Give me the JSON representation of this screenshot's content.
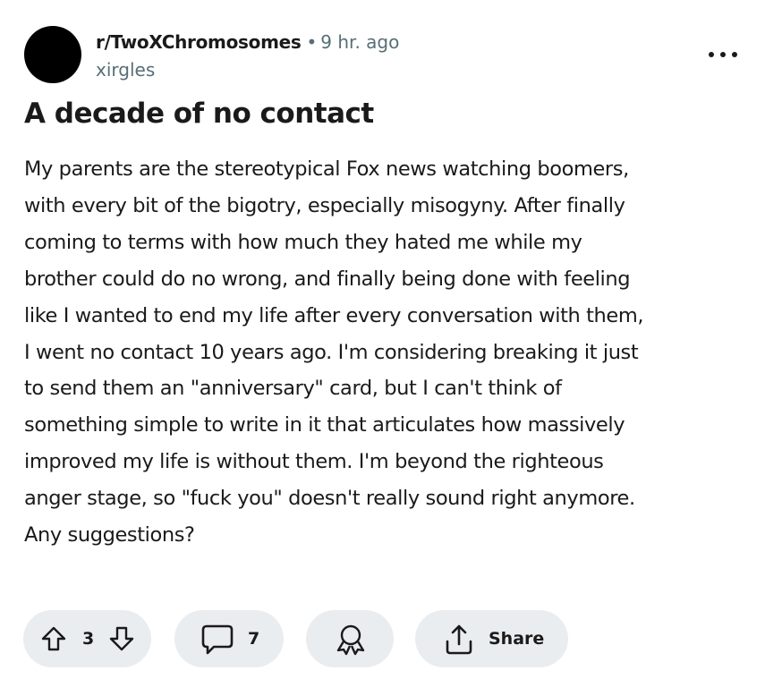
{
  "post": {
    "subreddit": "r/TwoXChromosomes",
    "separator": "•",
    "time": "9 hr. ago",
    "author": "xirgles",
    "title": "A decade of no contact",
    "body_lines": [
      "My parents are the stereotypical Fox news watching boomers,",
      "with every bit of the bigotry, especially misogyny. After finally",
      "coming to terms with how much they hated me while my",
      "brother could do no wrong, and finally being done with feeling",
      "like I wanted to end my life after every conversation with them,",
      "I went no contact 10 years ago. I'm considering breaking it just",
      "to send them an \"anniversary\" card, but I can't think of",
      "something simple to write in it that articulates how massively",
      "improved my life is without them. I'm beyond the righteous",
      "anger stage, so \"fuck you\" doesn't really sound right anymore.",
      "Any suggestions?"
    ]
  },
  "actions": {
    "vote_count": "3",
    "comment_count": "7",
    "share_label": "Share"
  },
  "icons": {
    "overflow": "more-horizontal-icon",
    "upvote": "arrow-up-icon",
    "downvote": "arrow-down-icon",
    "comment": "speech-bubble-icon",
    "award": "award-ribbon-icon",
    "share": "share-upload-icon"
  },
  "colors": {
    "text": "#1a1a1b",
    "meta": "#576f76",
    "pill_bg": "#eaedef",
    "avatar": "#000000"
  }
}
